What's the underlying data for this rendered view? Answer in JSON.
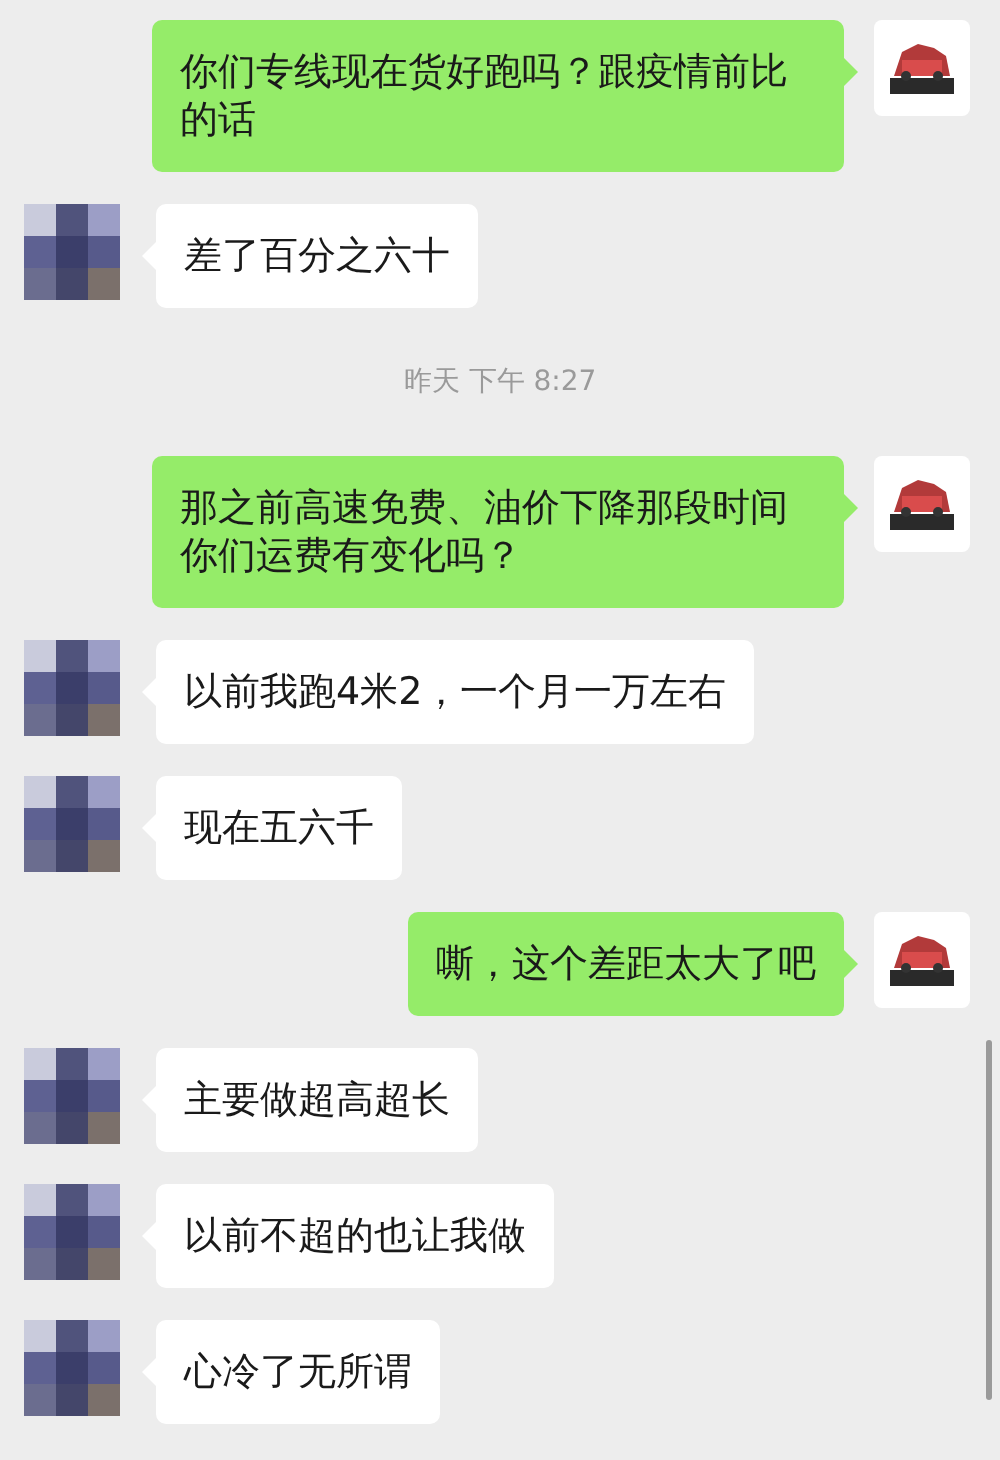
{
  "messages": [
    {
      "kind": "sent",
      "text": "你们专线现在货好跑吗？跟疫情前比的话"
    },
    {
      "kind": "received",
      "text": "差了百分之六十"
    },
    {
      "kind": "time",
      "text": "昨天 下午 8:27"
    },
    {
      "kind": "sent",
      "text": "那之前高速免费、油价下降那段时间你们运费有变化吗？"
    },
    {
      "kind": "received",
      "text": "以前我跑4米2，一个月一万左右"
    },
    {
      "kind": "received",
      "text": "现在五六千"
    },
    {
      "kind": "sent",
      "text": "嘶，这个差距太大了吧"
    },
    {
      "kind": "received",
      "text": "主要做超高超长"
    },
    {
      "kind": "received",
      "text": "以前不超的也让我做"
    },
    {
      "kind": "received",
      "text": "心冷了无所谓"
    }
  ]
}
